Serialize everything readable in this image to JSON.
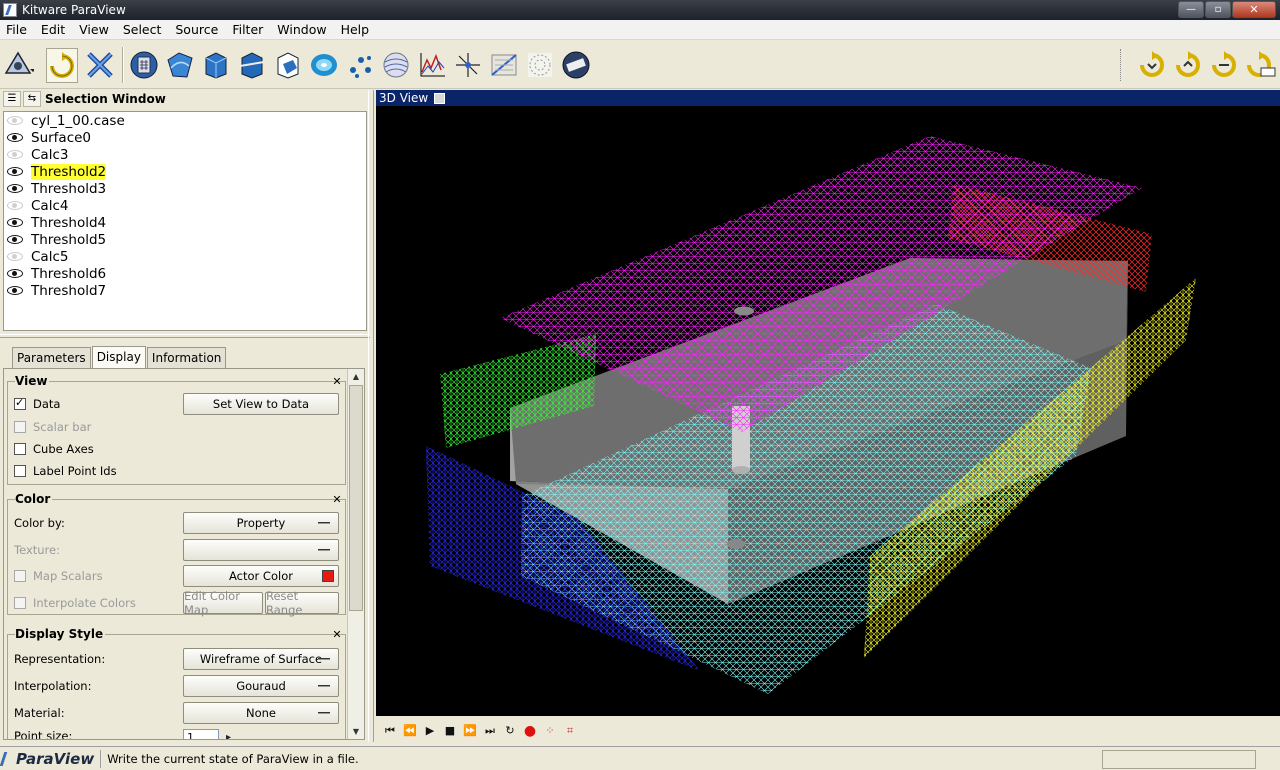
{
  "window": {
    "title": "Kitware ParaView",
    "min": "—",
    "max": "▫",
    "close": "✕"
  },
  "menu": [
    "File",
    "Edit",
    "View",
    "Select",
    "Source",
    "Filter",
    "Window",
    "Help"
  ],
  "selection_window": {
    "title": "Selection Window",
    "items": [
      {
        "label": "cyl_1_00.case",
        "visible": false
      },
      {
        "label": "Surface0",
        "visible": true
      },
      {
        "label": "Calc3",
        "visible": false
      },
      {
        "label": "Threshold2",
        "visible": true,
        "selected": true
      },
      {
        "label": "Threshold3",
        "visible": true
      },
      {
        "label": "Calc4",
        "visible": false
      },
      {
        "label": "Threshold4",
        "visible": true
      },
      {
        "label": "Threshold5",
        "visible": true
      },
      {
        "label": "Calc5",
        "visible": false
      },
      {
        "label": "Threshold6",
        "visible": true
      },
      {
        "label": "Threshold7",
        "visible": true
      }
    ]
  },
  "tabs": [
    {
      "label": "Parameters",
      "selected": false
    },
    {
      "label": "Display",
      "selected": true
    },
    {
      "label": "Information",
      "selected": false
    }
  ],
  "view_group": {
    "title": "View",
    "data_label": "Data",
    "data_checked": true,
    "scalar_bar": "Scalar bar",
    "cube_axes": "Cube Axes",
    "label_point_ids": "Label Point Ids",
    "set_view_button": "Set View to Data"
  },
  "color_group": {
    "title": "Color",
    "color_by_label": "Color by:",
    "color_by_value": "Property",
    "texture_label": "Texture:",
    "texture_value": "",
    "map_scalars": "Map Scalars",
    "actor_color_button": "Actor Color",
    "actor_color": "#e8190f",
    "interpolate_colors": "Interpolate Colors",
    "edit_color_map": "Edit Color Map",
    "reset_range": "Reset Range"
  },
  "display_style_group": {
    "title": "Display Style",
    "representation_label": "Representation:",
    "representation_value": "Wireframe of Surface",
    "interpolation_label": "Interpolation:",
    "interpolation_value": "Gouraud",
    "material_label": "Material:",
    "material_value": "None",
    "point_size_label": "Point size:",
    "point_size_value": "1"
  },
  "view3d": {
    "title": "3D View",
    "background": "#000000"
  },
  "statusbar": {
    "logo": "ParaView",
    "message": "Write the current state of ParaView in a file."
  },
  "colors": {
    "magenta": "#ff00ff",
    "cyan": "#66ffff",
    "yellow": "#ffff00",
    "blue": "#1a1aff",
    "green": "#33ff33",
    "red": "#ff1a1a",
    "gray": "#c8c8c8",
    "accent": "#0a246a"
  }
}
